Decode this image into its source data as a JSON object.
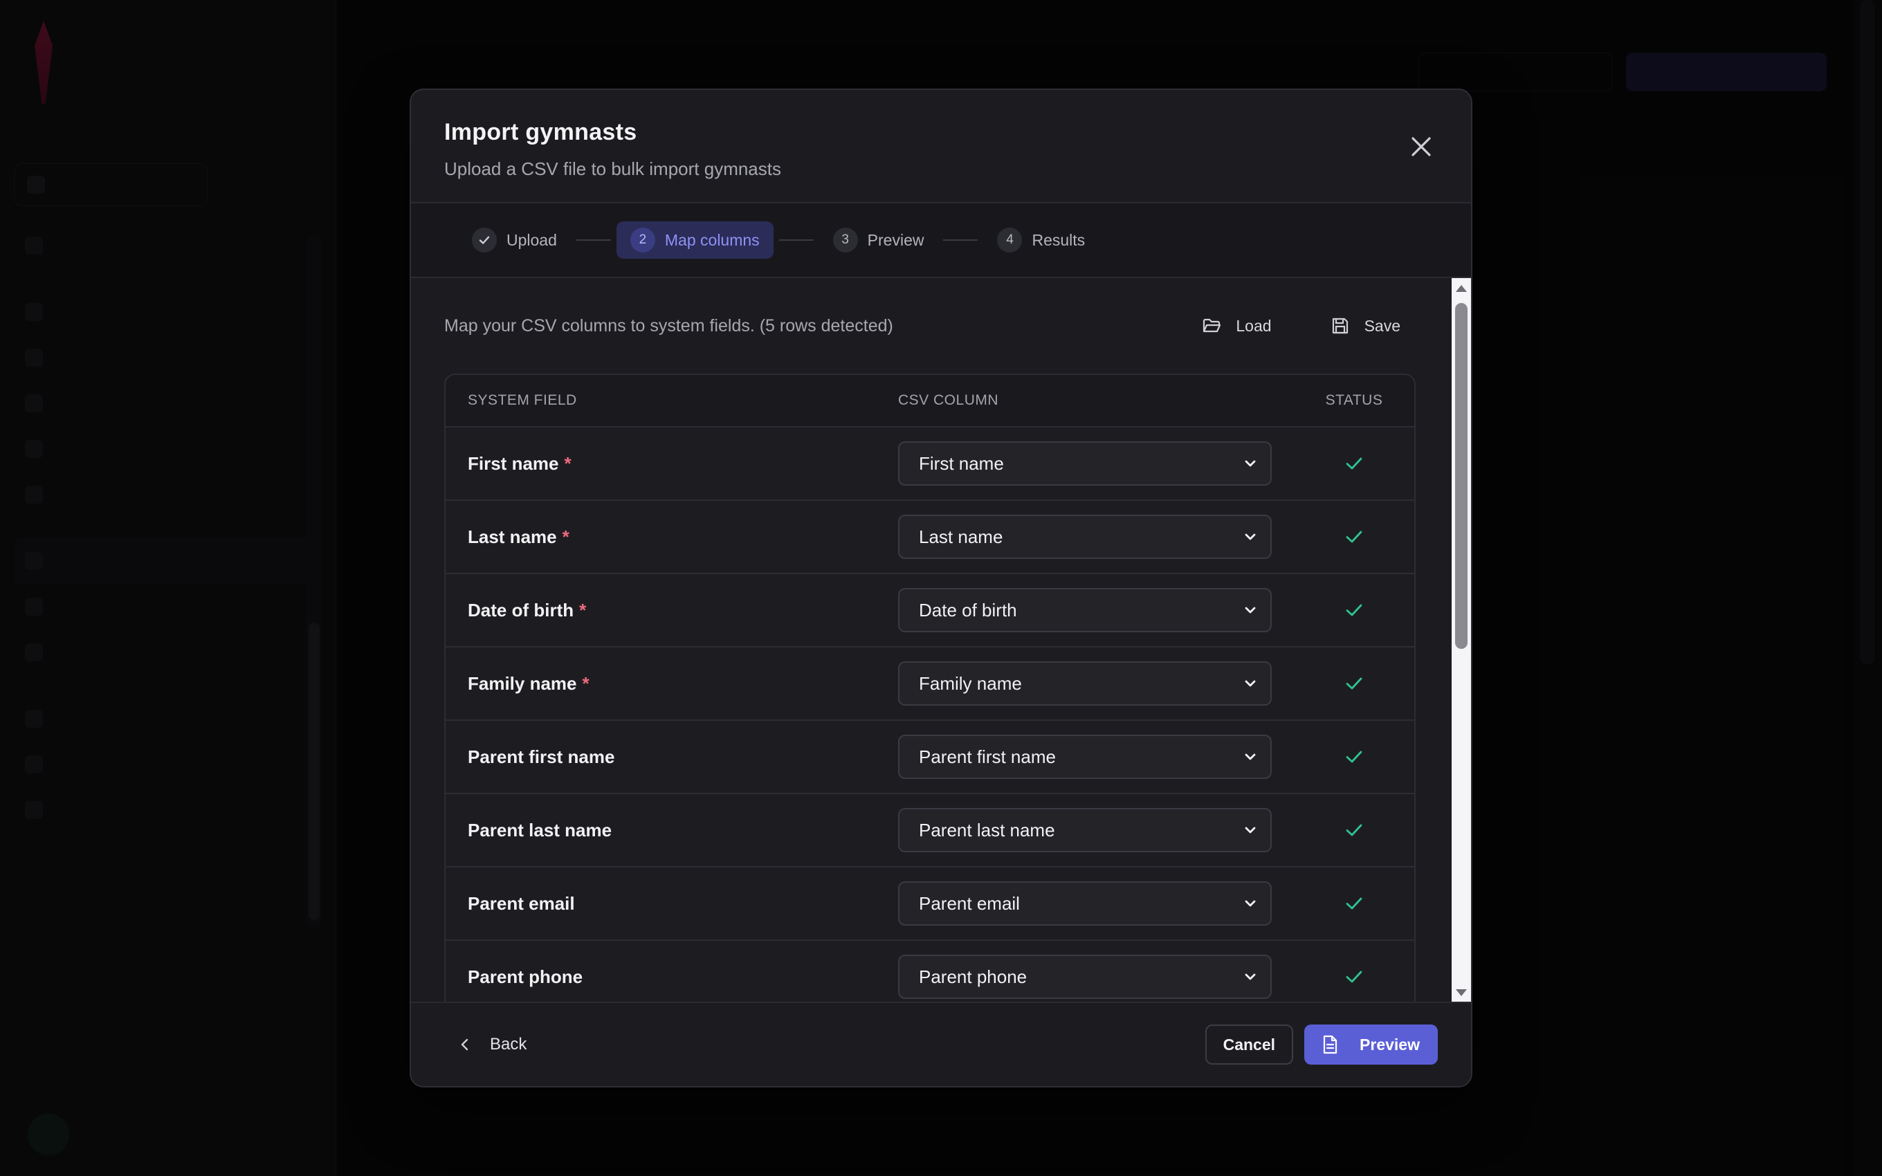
{
  "modal": {
    "title": "Import gymnasts",
    "subtitle": "Upload a CSV file to bulk import gymnasts",
    "steps": [
      {
        "num": "",
        "label": "Upload",
        "state": "done"
      },
      {
        "num": "2",
        "label": "Map columns",
        "state": "active"
      },
      {
        "num": "3",
        "label": "Preview",
        "state": "pending"
      },
      {
        "num": "4",
        "label": "Results",
        "state": "pending"
      }
    ],
    "description": "Map your CSV columns to system fields. (5 rows detected)",
    "load_label": "Load",
    "save_label": "Save",
    "table": {
      "headers": {
        "field": "SYSTEM FIELD",
        "csv": "CSV COLUMN",
        "status": "STATUS"
      },
      "rows": [
        {
          "field": "First name",
          "required": true,
          "csv": "First name"
        },
        {
          "field": "Last name",
          "required": true,
          "csv": "Last name"
        },
        {
          "field": "Date of birth",
          "required": true,
          "csv": "Date of birth"
        },
        {
          "field": "Family name",
          "required": true,
          "csv": "Family name"
        },
        {
          "field": "Parent first name",
          "required": false,
          "csv": "Parent first name"
        },
        {
          "field": "Parent last name",
          "required": false,
          "csv": "Parent last name"
        },
        {
          "field": "Parent email",
          "required": false,
          "csv": "Parent email"
        },
        {
          "field": "Parent phone",
          "required": false,
          "csv": "Parent phone"
        }
      ]
    },
    "footer": {
      "back_label": "Back",
      "cancel_label": "Cancel",
      "preview_label": "Preview"
    }
  },
  "colors": {
    "accent": "#5b5fd6",
    "active_step_bg": "#2b2c58",
    "check_green": "#2fc48f",
    "required_star": "#f06a7e"
  },
  "icons": {
    "close": "close-icon",
    "step_done": "check-icon",
    "load": "folder-open-icon",
    "save": "floppy-disk-icon",
    "dropdown": "chevron-down-icon",
    "status": "check-icon",
    "back": "chevron-left-icon",
    "preview": "document-icon"
  }
}
